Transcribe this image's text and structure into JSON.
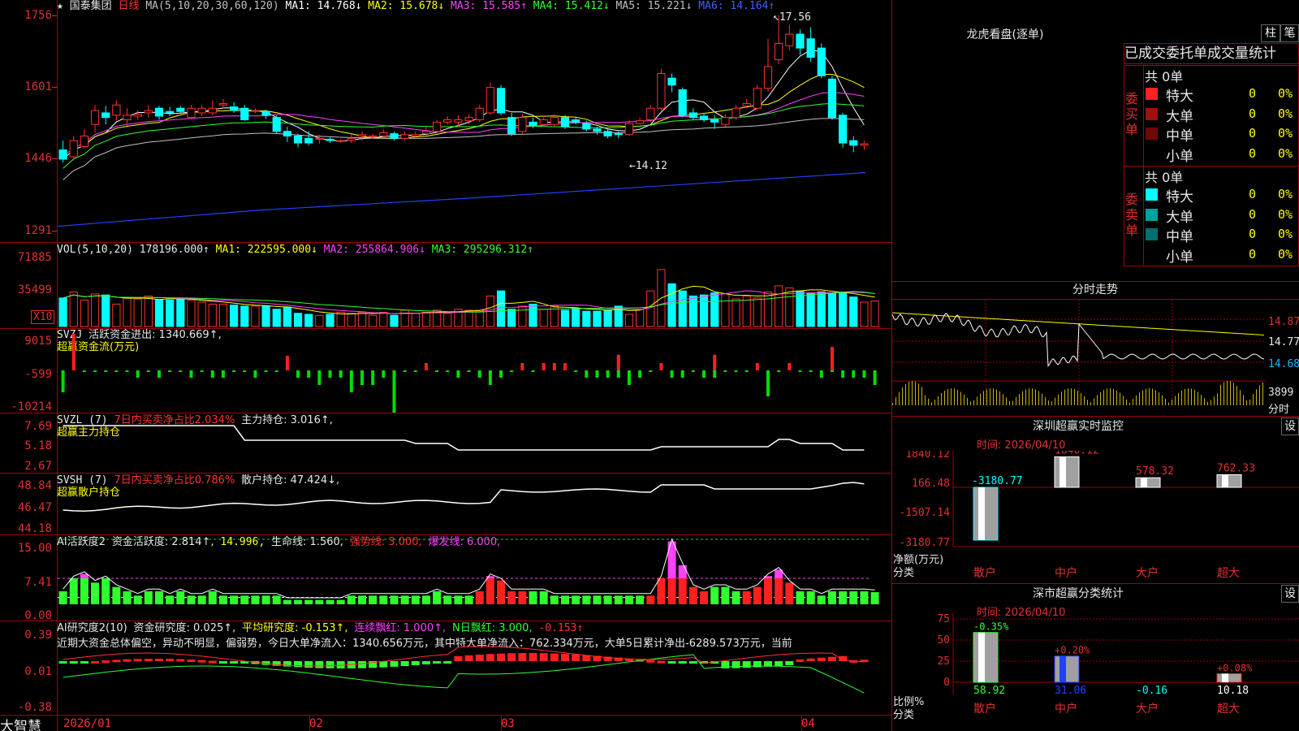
{
  "header": {
    "star": "★",
    "stock_name": "国泰集团",
    "period": "日线",
    "ma_label": "MA(5,10,20,30,60,120)",
    "ma": [
      {
        "text": "MA1: 14.768↓",
        "color": "#ffffff"
      },
      {
        "text": "MA2: 15.678↓",
        "color": "#ffff00"
      },
      {
        "text": "MA3: 15.585↑",
        "color": "#ff40ff"
      },
      {
        "text": "MA4: 15.412↓",
        "color": "#30ff30"
      },
      {
        "text": "MA5: 15.221↓",
        "color": "#c0c0c0"
      },
      {
        "text": "MA6: 14.164↑",
        "color": "#4060ff"
      }
    ]
  },
  "price_axis": [
    "1756",
    "1601",
    "1446",
    "1291"
  ],
  "price_annotations": {
    "high": "17.56",
    "low": "14.12"
  },
  "vol": {
    "label": "VOL(5,10,20)",
    "value": "178196.000↑",
    "ma1": "MA1: 222595.000↓",
    "ma2": "MA2: 255864.906↓",
    "ma3": "MA3: 295296.312↑",
    "axis": [
      "71885",
      "35499"
    ],
    "unit": "X10"
  },
  "svzj": {
    "label": "SVZJ",
    "text1": "活跃资金进出: 1340.669↑,",
    "text2": "超赢资金流(万元)",
    "axis": [
      "9015",
      "-599",
      "-10214"
    ]
  },
  "svzl": {
    "label": "SVZL (7)",
    "text1": "7日内买卖净占比2.034%",
    "text2": "主力持仓: 3.016↑,",
    "text3": "超赢主力持仓",
    "axis": [
      "7.69",
      "5.18",
      "2.67"
    ]
  },
  "svsh": {
    "label": "SVSH (7)",
    "text1": "7日内买卖净占比0.786%",
    "text2": "散户持仓: 47.424↓,",
    "text3": "超赢散户持仓",
    "axis": [
      "48.84",
      "46.47",
      "44.18"
    ]
  },
  "ai1": {
    "label": "AI活跃度2",
    "t1": "资金活跃度: 2.814↑,",
    "t2": "14.996,",
    "t3": "生命线: 1.560,",
    "t4": "强势线: 3.000,",
    "t5": "爆发线: 6.000,",
    "axis": [
      "15.00",
      "7.41",
      "0.00"
    ]
  },
  "ai2": {
    "label": "AI研究度2(10)",
    "t1": "资金研究度: 0.025↑,",
    "t2": "平均研究度: -0.153↑,",
    "t3": "连续飘红: 1.000↑,",
    "t4": "N日飘红: 3.000,",
    "t5": "-0.153↑",
    "summary": "近期大资金总体偏空，异动不明显，偏弱势，今日大单净流入：1340.656万元，其中特大单净流入：762.334万元，大单5日累计净出-6289.573万元，当前",
    "axis": [
      "0.39",
      "0.01",
      "-0.38"
    ]
  },
  "x_axis": [
    "2026/01",
    "02",
    "03",
    "04"
  ],
  "brand": "大智慧",
  "right": {
    "longhu_title": "龙虎看盘(逐单)",
    "btn_bar": "柱",
    "btn_pen": "笔",
    "tabs": [
      "已成交",
      "委托单",
      "成交量统计"
    ],
    "buy_label": "委买单",
    "sell_label": "委卖单",
    "buy_total": "共 0单",
    "sell_total": "共 0单",
    "buy_rows": [
      {
        "label": "特大",
        "count": "0",
        "pct": "0%",
        "color": "#ff2020"
      },
      {
        "label": "大单",
        "count": "0",
        "pct": "0%",
        "color": "#a01010"
      },
      {
        "label": "中单",
        "count": "0",
        "pct": "0%",
        "color": "#700808"
      },
      {
        "label": "小单",
        "count": "0",
        "pct": "0%",
        "color": "#000"
      }
    ],
    "sell_rows": [
      {
        "label": "特大",
        "count": "0",
        "pct": "0%",
        "color": "#00ffff"
      },
      {
        "label": "大单",
        "count": "0",
        "pct": "0%",
        "color": "#00a0a0"
      },
      {
        "label": "中单",
        "count": "0",
        "pct": "0%",
        "color": "#007070"
      },
      {
        "label": "小单",
        "count": "0",
        "pct": "0%",
        "color": "#000"
      }
    ],
    "minute_title": "分时走势",
    "minute_axis": [
      "14.87",
      "14.77",
      "14.68",
      "3899"
    ],
    "minute_vol_label": "分时",
    "sz_title": "深圳超赢实时监控",
    "sz_btn": "设",
    "sz_time": "时间: 2026/04/10",
    "sz_axis": [
      "1840.12",
      "166.48",
      "-1507.14",
      "-3180.77"
    ],
    "sz_values": [
      {
        "name": "散户",
        "v": "-3180.77"
      },
      {
        "name": "中户",
        "v": "1840.12"
      },
      {
        "name": "大户",
        "v": "578.32"
      },
      {
        "name": "超大",
        "v": "762.33"
      }
    ],
    "sz_side": [
      "净额(万元)",
      "分类"
    ],
    "ss_title": "深市超赢分类统计",
    "ss_btn": "设",
    "ss_time": "时间: 2026/04/10",
    "ss_axis": [
      "75",
      "50",
      "25",
      "0"
    ],
    "ss_bars": [
      {
        "name": "散户",
        "delta": "-0.35%",
        "val": "58.92"
      },
      {
        "name": "中户",
        "delta": "+0.20%",
        "val": "31.06"
      },
      {
        "name": "大户",
        "delta": "",
        "val": "-0.16"
      },
      {
        "name": "超大",
        "delta": "+0.08%",
        "val": "10.18"
      }
    ],
    "ss_side": [
      "比例%",
      "分类"
    ]
  },
  "chart_data": [
    {
      "type": "candlestick",
      "title": "国泰集团 日线",
      "candles": [
        {
          "o": 14.65,
          "c": 14.45,
          "h": 14.85,
          "l": 14.38
        },
        {
          "o": 14.5,
          "c": 14.85,
          "h": 14.95,
          "l": 14.42
        },
        {
          "o": 14.72,
          "c": 14.95,
          "h": 15.1,
          "l": 14.68
        },
        {
          "o": 15.2,
          "c": 15.5,
          "h": 15.62,
          "l": 15.02
        },
        {
          "o": 15.45,
          "c": 15.35,
          "h": 15.6,
          "l": 15.2
        },
        {
          "o": 15.4,
          "c": 15.62,
          "h": 15.72,
          "l": 15.28
        },
        {
          "o": 15.3,
          "c": 15.4,
          "h": 15.55,
          "l": 15.18
        },
        {
          "o": 15.38,
          "c": 15.42,
          "h": 15.5,
          "l": 15.3
        },
        {
          "o": 15.45,
          "c": 15.5,
          "h": 15.62,
          "l": 15.35
        },
        {
          "o": 15.55,
          "c": 15.38,
          "h": 15.6,
          "l": 15.3
        },
        {
          "o": 15.48,
          "c": 15.45,
          "h": 15.58,
          "l": 15.38
        },
        {
          "o": 15.55,
          "c": 15.48,
          "h": 15.6,
          "l": 15.45
        },
        {
          "o": 15.35,
          "c": 15.55,
          "h": 15.62,
          "l": 15.3
        },
        {
          "o": 15.45,
          "c": 15.55,
          "h": 15.62,
          "l": 15.38
        },
        {
          "o": 15.45,
          "c": 15.55,
          "h": 15.72,
          "l": 15.4
        },
        {
          "o": 15.62,
          "c": 15.65,
          "h": 15.75,
          "l": 15.55
        },
        {
          "o": 15.58,
          "c": 15.5,
          "h": 15.68,
          "l": 15.45
        },
        {
          "o": 15.55,
          "c": 15.3,
          "h": 15.62,
          "l": 15.28
        },
        {
          "o": 15.48,
          "c": 15.5,
          "h": 15.55,
          "l": 15.44
        },
        {
          "o": 15.48,
          "c": 15.4,
          "h": 15.52,
          "l": 15.32
        },
        {
          "o": 15.35,
          "c": 15.05,
          "h": 15.4,
          "l": 15.0
        },
        {
          "o": 15.05,
          "c": 14.95,
          "h": 15.15,
          "l": 14.82
        },
        {
          "o": 14.95,
          "c": 14.8,
          "h": 15.0,
          "l": 14.7
        },
        {
          "o": 14.9,
          "c": 14.8,
          "h": 15.05,
          "l": 14.75
        },
        {
          "o": 14.88,
          "c": 14.9,
          "h": 14.98,
          "l": 14.78
        },
        {
          "o": 14.88,
          "c": 14.85,
          "h": 14.92,
          "l": 14.8
        },
        {
          "o": 14.85,
          "c": 14.85,
          "h": 14.88,
          "l": 14.8
        },
        {
          "o": 14.85,
          "c": 14.9,
          "h": 15.0,
          "l": 14.8
        },
        {
          "o": 14.95,
          "c": 14.98,
          "h": 15.05,
          "l": 14.85
        },
        {
          "o": 14.95,
          "c": 14.95,
          "h": 15.0,
          "l": 14.88
        },
        {
          "o": 14.95,
          "c": 15.02,
          "h": 15.1,
          "l": 14.9
        },
        {
          "o": 15.0,
          "c": 14.9,
          "h": 15.05,
          "l": 14.85
        },
        {
          "o": 14.9,
          "c": 14.98,
          "h": 15.05,
          "l": 14.85
        },
        {
          "o": 14.95,
          "c": 14.98,
          "h": 15.05,
          "l": 14.9
        },
        {
          "o": 15.0,
          "c": 15.05,
          "h": 15.15,
          "l": 14.95
        },
        {
          "o": 15.05,
          "c": 15.25,
          "h": 15.3,
          "l": 15.0
        },
        {
          "o": 15.25,
          "c": 15.3,
          "h": 15.38,
          "l": 15.2
        },
        {
          "o": 15.25,
          "c": 15.3,
          "h": 15.4,
          "l": 15.15
        },
        {
          "o": 15.28,
          "c": 15.35,
          "h": 15.42,
          "l": 15.2
        },
        {
          "o": 15.3,
          "c": 15.55,
          "h": 15.62,
          "l": 15.25
        },
        {
          "o": 15.45,
          "c": 16.0,
          "h": 16.1,
          "l": 15.4
        },
        {
          "o": 15.98,
          "c": 15.45,
          "h": 16.05,
          "l": 15.4
        },
        {
          "o": 15.35,
          "c": 15.0,
          "h": 15.45,
          "l": 14.95
        },
        {
          "o": 15.05,
          "c": 15.35,
          "h": 15.42,
          "l": 15.0
        },
        {
          "o": 15.25,
          "c": 15.18,
          "h": 15.35,
          "l": 15.12
        },
        {
          "o": 15.2,
          "c": 15.3,
          "h": 15.35,
          "l": 15.15
        },
        {
          "o": 15.2,
          "c": 15.35,
          "h": 15.42,
          "l": 15.15
        },
        {
          "o": 15.35,
          "c": 15.15,
          "h": 15.4,
          "l": 15.1
        },
        {
          "o": 15.3,
          "c": 15.25,
          "h": 15.35,
          "l": 15.2
        },
        {
          "o": 15.22,
          "c": 15.1,
          "h": 15.28,
          "l": 15.05
        },
        {
          "o": 15.1,
          "c": 15.05,
          "h": 15.15,
          "l": 14.98
        },
        {
          "o": 15.05,
          "c": 14.95,
          "h": 15.1,
          "l": 14.9
        },
        {
          "o": 15.0,
          "c": 14.98,
          "h": 15.05,
          "l": 14.9
        },
        {
          "o": 14.98,
          "c": 15.22,
          "h": 15.3,
          "l": 14.95
        },
        {
          "o": 15.22,
          "c": 15.28,
          "h": 15.35,
          "l": 15.2
        },
        {
          "o": 15.3,
          "c": 15.55,
          "h": 15.62,
          "l": 15.25
        },
        {
          "o": 15.55,
          "c": 16.3,
          "h": 16.4,
          "l": 15.5
        },
        {
          "o": 16.2,
          "c": 16.05,
          "h": 16.3,
          "l": 15.9
        },
        {
          "o": 15.95,
          "c": 15.4,
          "h": 16.0,
          "l": 15.35
        },
        {
          "o": 15.45,
          "c": 15.35,
          "h": 15.55,
          "l": 15.3
        },
        {
          "o": 15.38,
          "c": 15.3,
          "h": 15.45,
          "l": 15.25
        },
        {
          "o": 15.3,
          "c": 15.25,
          "h": 15.4,
          "l": 15.1
        },
        {
          "o": 15.2,
          "c": 15.35,
          "h": 15.42,
          "l": 15.15
        },
        {
          "o": 15.35,
          "c": 15.55,
          "h": 15.62,
          "l": 15.3
        },
        {
          "o": 15.6,
          "c": 15.65,
          "h": 15.75,
          "l": 15.55
        },
        {
          "o": 15.55,
          "c": 15.98,
          "h": 16.05,
          "l": 15.5
        },
        {
          "o": 15.98,
          "c": 16.45,
          "h": 17.05,
          "l": 15.9
        },
        {
          "o": 16.6,
          "c": 16.95,
          "h": 17.56,
          "l": 16.5
        },
        {
          "o": 16.9,
          "c": 17.15,
          "h": 17.35,
          "l": 16.8
        },
        {
          "o": 17.15,
          "c": 16.85,
          "h": 17.25,
          "l": 16.7
        },
        {
          "o": 17.05,
          "c": 16.65,
          "h": 17.3,
          "l": 16.55
        },
        {
          "o": 16.85,
          "c": 16.25,
          "h": 16.95,
          "l": 16.2
        },
        {
          "o": 16.18,
          "c": 15.35,
          "h": 16.25,
          "l": 15.3
        },
        {
          "o": 15.4,
          "c": 14.8,
          "h": 15.45,
          "l": 14.7
        },
        {
          "o": 14.85,
          "c": 14.75,
          "h": 14.95,
          "l": 14.6
        },
        {
          "o": 14.75,
          "c": 14.78,
          "h": 14.85,
          "l": 14.65
        }
      ],
      "ylim": [
        12.8,
        17.8
      ],
      "y_ticks": [
        "1756",
        "1601",
        "1446",
        "1291"
      ]
    },
    {
      "type": "bar",
      "title": "VOL(5,10,20)",
      "values": [
        28,
        34,
        26,
        32,
        31,
        22,
        28,
        27,
        30,
        26,
        26,
        27,
        26,
        24,
        22,
        22,
        21,
        20,
        20,
        20,
        17,
        19,
        13,
        12,
        11,
        12,
        14,
        13,
        14,
        11,
        14,
        11,
        16,
        13,
        14,
        16,
        13,
        17,
        16,
        16,
        30,
        35,
        17,
        20,
        22,
        17,
        20,
        16,
        18,
        15,
        15,
        16,
        20,
        12,
        17,
        35,
        56,
        42,
        35,
        30,
        31,
        33,
        32,
        27,
        30,
        28,
        34,
        40,
        38,
        35,
        33,
        34,
        33,
        33,
        29,
        24,
        25
      ],
      "ylim": [
        0,
        75
      ],
      "y_ticks": [
        "71885",
        "35499"
      ]
    }
  ]
}
